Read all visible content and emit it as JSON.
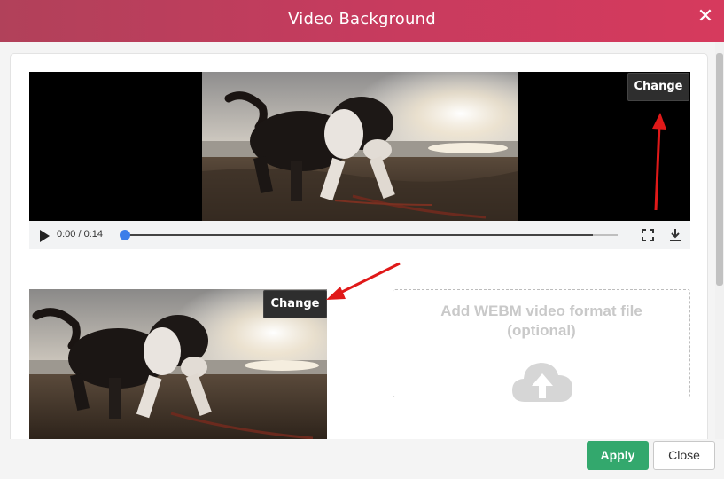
{
  "dialog": {
    "title": "Video Background",
    "close_icon": "close-icon"
  },
  "video_player": {
    "change_label": "Change",
    "time": "0:00 / 0:14",
    "progress_fraction": 0.95,
    "icons": [
      "play-icon",
      "fullscreen-icon",
      "download-icon"
    ]
  },
  "thumbnail": {
    "change_label": "Change"
  },
  "webm_upload": {
    "label_line1": "Add WEBM video format file",
    "label_line2": "(optional)",
    "icon": "cloud-upload-icon"
  },
  "footer": {
    "apply_label": "Apply",
    "close_label": "Close"
  },
  "colors": {
    "header_gradient_start": "#b1415a",
    "header_gradient_end": "#d63a5d",
    "apply_green": "#33a86d",
    "progress_knob": "#3b7de9",
    "annotation_arrow": "#e01919"
  }
}
